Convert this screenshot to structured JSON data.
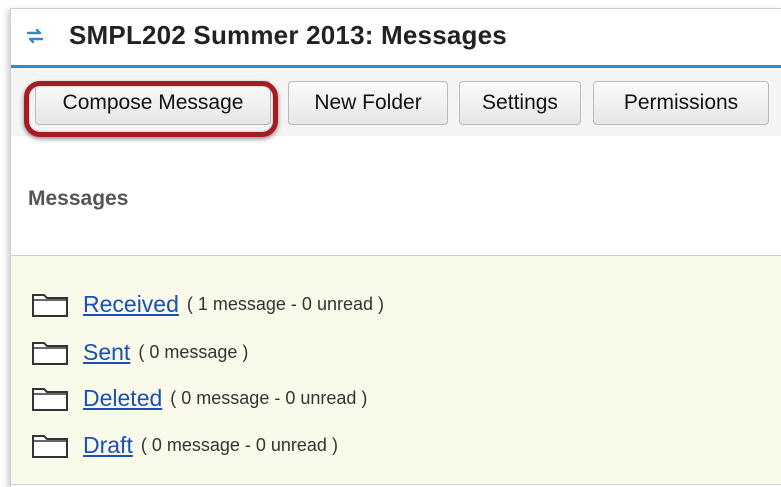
{
  "header": {
    "title": "SMPL202 Summer 2013: Messages",
    "icon": "refresh-arrows-icon",
    "accent_color": "#2f8ec8"
  },
  "toolbar": {
    "compose_label": "Compose Message",
    "new_folder_label": "New Folder",
    "settings_label": "Settings",
    "permissions_label": "Permissions",
    "highlight_color": "#a51c24"
  },
  "main": {
    "heading": "Messages",
    "folders": [
      {
        "name": "Received",
        "count": "( 1 message - 0 unread )"
      },
      {
        "name": "Sent",
        "count": "( 0 message )"
      },
      {
        "name": "Deleted",
        "count": "( 0 message - 0 unread )"
      },
      {
        "name": "Draft",
        "count": "( 0 message - 0 unread )"
      }
    ],
    "panel_color": "#fafaeb",
    "link_color": "#1a4fb8"
  }
}
